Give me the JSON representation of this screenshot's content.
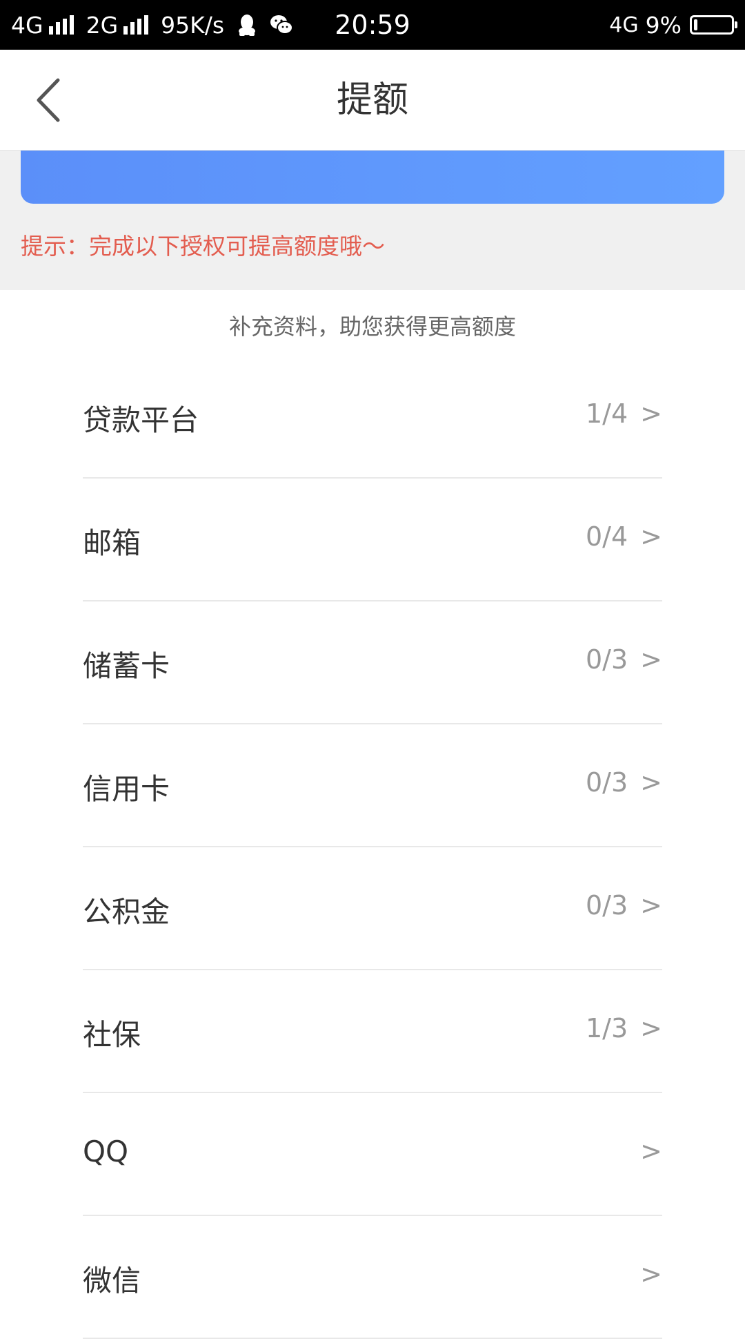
{
  "status_bar": {
    "network1": "4G",
    "network2": "2G",
    "speed": "95K/s",
    "time": "20:59",
    "right_network": "4G",
    "battery_pct": "9%",
    "battery_level": 0.09,
    "icons": [
      "qq-icon",
      "wechat-icon"
    ]
  },
  "nav": {
    "title": "提额",
    "back_icon": "chevron-left-icon"
  },
  "tip": "提示：完成以下授权可提高额度哦～",
  "subtitle": "补充资料，助您获得更高额度",
  "colors": {
    "banner_start": "#5b8ff9",
    "banner_end": "#63a0ff",
    "tip_red": "#e35d4f"
  },
  "items": [
    {
      "label": "贷款平台",
      "progress": "1/4",
      "chevron": ">"
    },
    {
      "label": "邮箱",
      "progress": "0/4",
      "chevron": ">"
    },
    {
      "label": "储蓄卡",
      "progress": "0/3",
      "chevron": ">"
    },
    {
      "label": "信用卡",
      "progress": "0/3",
      "chevron": ">"
    },
    {
      "label": "公积金",
      "progress": "0/3",
      "chevron": ">"
    },
    {
      "label": "社保",
      "progress": "1/3",
      "chevron": ">"
    },
    {
      "label": "QQ",
      "progress": "",
      "chevron": ">"
    },
    {
      "label": "微信",
      "progress": "",
      "chevron": ">"
    }
  ]
}
